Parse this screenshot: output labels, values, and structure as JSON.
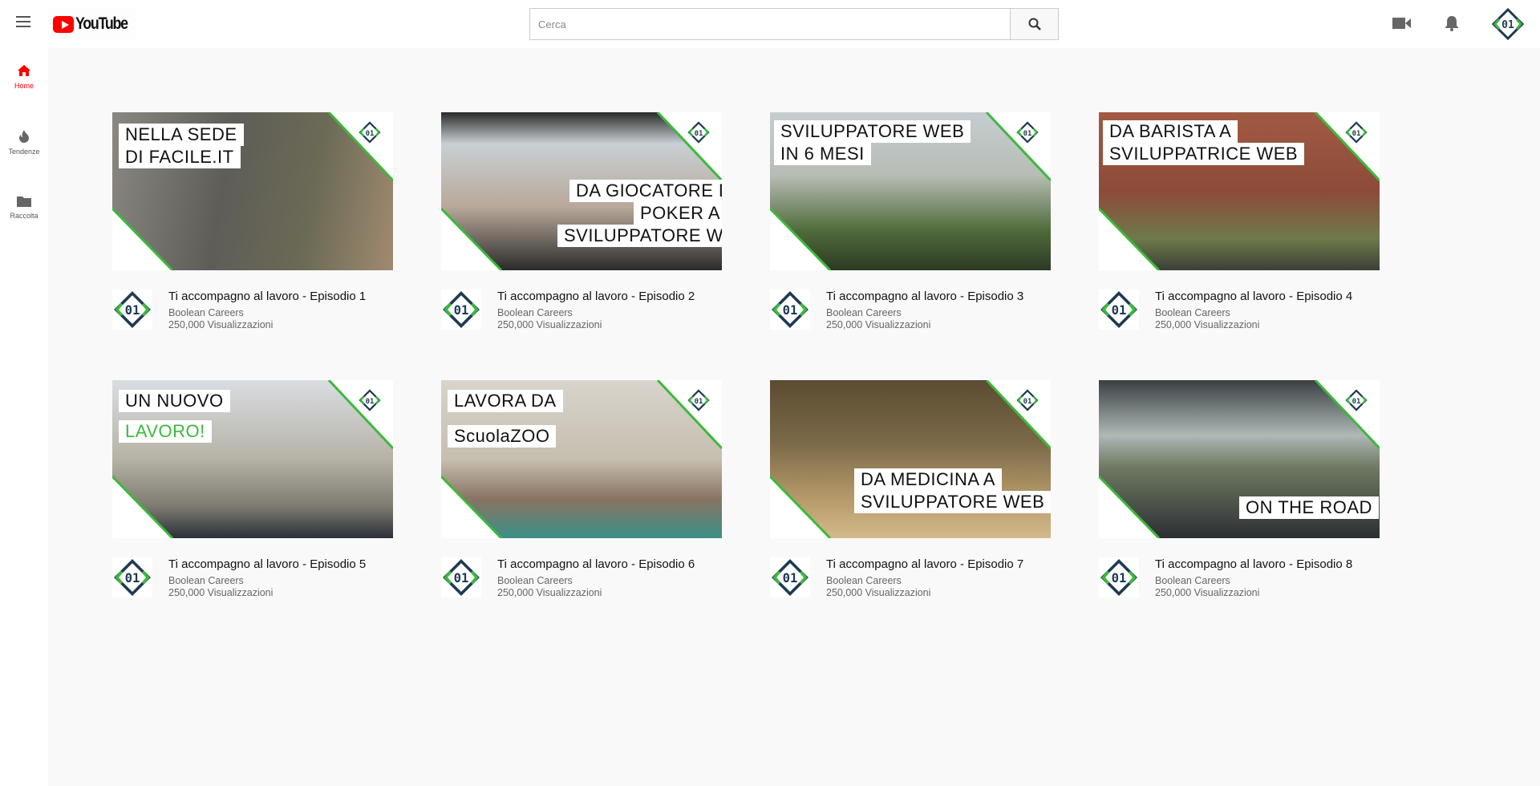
{
  "header": {
    "logo": "YouTube",
    "search_placeholder": "Cerca"
  },
  "sidebar": {
    "items": [
      {
        "label": "Home",
        "icon": "home-icon",
        "active": true
      },
      {
        "label": "Tendenze",
        "icon": "fire-icon"
      },
      {
        "label": "Raccolta",
        "icon": "folder-icon"
      }
    ]
  },
  "colors": {
    "accent": "#ff0000",
    "brand_green": "#3cb93c",
    "brand_navy": "#1e3a52"
  },
  "videos": [
    {
      "title": "Ti accompagno al lavoro - Episodio 1",
      "channel": "Boolean Careers",
      "views": "250,000 Visualizzazioni",
      "captions": [
        "NELLA SEDE",
        "DI FACILE.IT"
      ]
    },
    {
      "title": "Ti accompagno al lavoro - Episodio 2",
      "channel": "Boolean Careers",
      "views": "250,000 Visualizzazioni",
      "captions": [
        "DA GIOCATORE DI",
        "POKER A",
        "SVILUPPATORE WEB"
      ]
    },
    {
      "title": "Ti accompagno al lavoro - Episodio 3",
      "channel": "Boolean Careers",
      "views": "250,000 Visualizzazioni",
      "captions": [
        "SVILUPPATORE WEB",
        "IN 6 MESI"
      ]
    },
    {
      "title": "Ti accompagno al lavoro - Episodio 4",
      "channel": "Boolean Careers",
      "views": "250,000 Visualizzazioni",
      "captions": [
        "DA BARISTA A",
        "SVILUPPATRICE WEB"
      ]
    },
    {
      "title": "Ti accompagno al lavoro - Episodio 5",
      "channel": "Boolean Careers",
      "views": "250,000 Visualizzazioni",
      "captions": [
        "UN NUOVO",
        "LAVORO!"
      ]
    },
    {
      "title": "Ti accompagno al lavoro - Episodio 6",
      "channel": "Boolean Careers",
      "views": "250,000 Visualizzazioni",
      "captions": [
        "LAVORA DA",
        "ScuolaZOO"
      ]
    },
    {
      "title": "Ti accompagno al lavoro - Episodio 7",
      "channel": "Boolean Careers",
      "views": "250,000 Visualizzazioni",
      "captions": [
        "DA MEDICINA A",
        "SVILUPPATORE WEB"
      ]
    },
    {
      "title": "Ti accompagno al lavoro - Episodio 8",
      "channel": "Boolean Careers",
      "views": "250,000 Visualizzazioni",
      "captions": [
        "ON THE ROAD"
      ]
    }
  ]
}
